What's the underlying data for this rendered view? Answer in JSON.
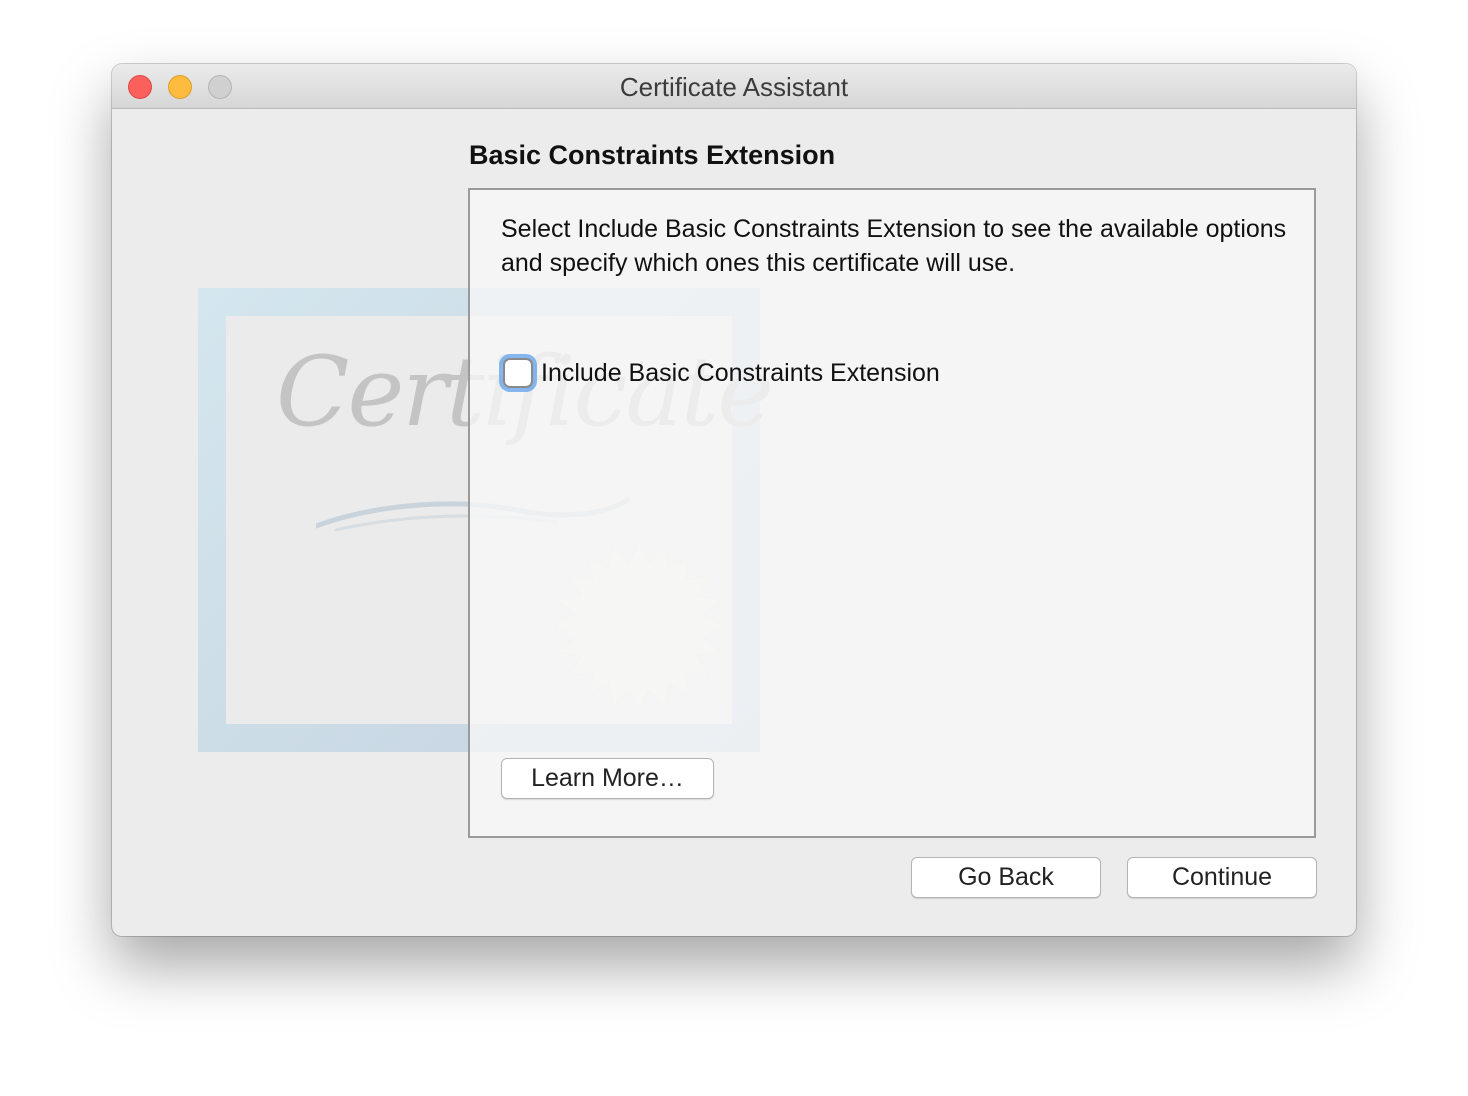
{
  "window": {
    "title": "Certificate Assistant",
    "controls": {
      "close": "red-close-button",
      "minimize": "yellow-minimize-button",
      "zoom": "gray-zoom-button"
    }
  },
  "illustration": {
    "word": "Certificate",
    "icon": "certificate-illustration"
  },
  "section": {
    "title": "Basic Constraints Extension",
    "description": "Select Include Basic Constraints Extension to see the available options and specify which ones this certificate will use.",
    "checkbox": {
      "label": "Include Basic Constraints Extension",
      "checked": false
    },
    "learn_more_label": "Learn More…"
  },
  "footer": {
    "go_back_label": "Go Back",
    "continue_label": "Continue"
  },
  "colors": {
    "close": "#fc605c",
    "minimize": "#fdbc40",
    "zoom": "#d0d0d0",
    "focus_ring": "#5fa0eb"
  }
}
